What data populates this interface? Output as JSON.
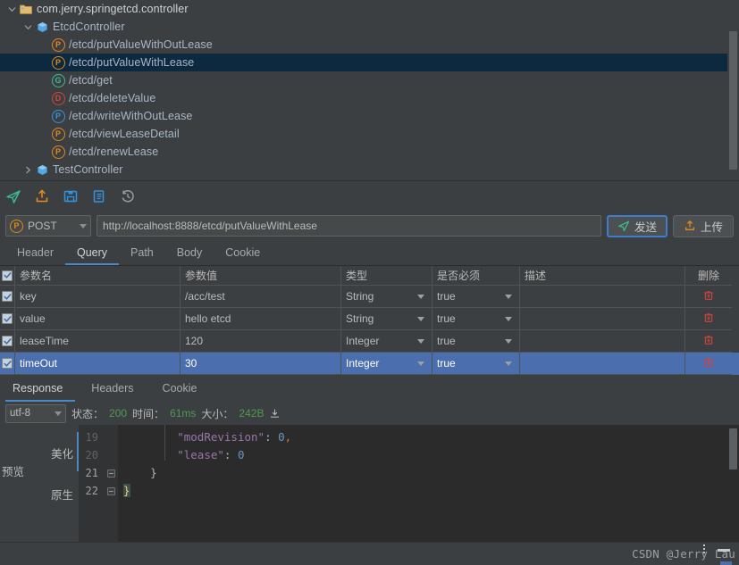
{
  "tree": {
    "items": [
      {
        "label": "com.jerry.springetcd.controller",
        "icon": "folder-icon",
        "indent": 0,
        "chevron": "down",
        "selected": false,
        "kind": "package"
      },
      {
        "label": "EtcdController",
        "icon": "class-icon",
        "indent": 1,
        "chevron": "down",
        "selected": false,
        "kind": "class"
      },
      {
        "label": "/etcd/putValueWithOutLease",
        "icon": "method-badge-post",
        "indent": 2,
        "chevron": "none",
        "selected": false,
        "kind": "endpoint",
        "method": "POST",
        "badge": "P"
      },
      {
        "label": "/etcd/putValueWithLease",
        "icon": "method-badge-post",
        "indent": 2,
        "chevron": "none",
        "selected": true,
        "kind": "endpoint",
        "method": "POST",
        "badge": "P"
      },
      {
        "label": "/etcd/get",
        "icon": "method-badge-get",
        "indent": 2,
        "chevron": "none",
        "selected": false,
        "kind": "endpoint",
        "method": "GET",
        "badge": "G"
      },
      {
        "label": "/etcd/deleteValue",
        "icon": "method-badge-delete",
        "indent": 2,
        "chevron": "none",
        "selected": false,
        "kind": "endpoint",
        "method": "DELETE",
        "badge": "D"
      },
      {
        "label": "/etcd/writeWithOutLease",
        "icon": "method-badge-put",
        "indent": 2,
        "chevron": "none",
        "selected": false,
        "kind": "endpoint",
        "method": "PUT",
        "badge": "P"
      },
      {
        "label": "/etcd/viewLeaseDetail",
        "icon": "method-badge-post",
        "indent": 2,
        "chevron": "none",
        "selected": false,
        "kind": "endpoint",
        "method": "POST",
        "badge": "P"
      },
      {
        "label": "/etcd/renewLease",
        "icon": "method-badge-post",
        "indent": 2,
        "chevron": "none",
        "selected": false,
        "kind": "endpoint",
        "method": "POST",
        "badge": "P"
      },
      {
        "label": "TestController",
        "icon": "class-icon",
        "indent": 1,
        "chevron": "right",
        "selected": false,
        "kind": "class"
      }
    ]
  },
  "toolbar": {
    "icons": [
      {
        "name": "send-icon",
        "color": "#3ebb8f"
      },
      {
        "name": "upload-icon",
        "color": "#e08a1e"
      },
      {
        "name": "save-icon",
        "color": "#3592e0"
      },
      {
        "name": "copy-doc-icon",
        "color": "#3592e0"
      },
      {
        "name": "history-icon",
        "color": "#9a9a9a"
      }
    ]
  },
  "request": {
    "method": "POST",
    "method_badge": "P",
    "url": "http://localhost:8888/etcd/putValueWithLease",
    "url_placeholder": "",
    "send_label": "发送",
    "upload_label": "上传"
  },
  "param_tabs": [
    {
      "label": "Header",
      "active": false
    },
    {
      "label": "Query",
      "active": true
    },
    {
      "label": "Path",
      "active": false
    },
    {
      "label": "Body",
      "active": false
    },
    {
      "label": "Cookie",
      "active": false
    }
  ],
  "params_table": {
    "columns": [
      "参数名",
      "参数值",
      "类型",
      "是否必须",
      "描述",
      "删除"
    ],
    "rows": [
      {
        "checked": true,
        "name": "key",
        "value": "/acc/test",
        "type": "String",
        "required": "true",
        "desc": "",
        "selected": false,
        "editing_cell": ""
      },
      {
        "checked": true,
        "name": "value",
        "value": "hello etcd",
        "type": "String",
        "required": "true",
        "desc": "",
        "selected": false,
        "editing_cell": ""
      },
      {
        "checked": true,
        "name": "leaseTime",
        "value": "120",
        "type": "Integer",
        "required": "true",
        "desc": "",
        "selected": false,
        "editing_cell": ""
      },
      {
        "checked": true,
        "name": "timeOut",
        "value": "30",
        "type": "Integer",
        "required": "true",
        "desc": "",
        "selected": true,
        "editing_cell": "desc"
      }
    ]
  },
  "response_tabs": [
    {
      "label": "Response",
      "active": true
    },
    {
      "label": "Headers",
      "active": false
    },
    {
      "label": "Cookie",
      "active": false
    }
  ],
  "response_status": {
    "encoding": "utf-8",
    "status_label": "状态：",
    "status_value": "200",
    "time_label": "时间：",
    "time_value": "61ms",
    "size_label": "大小：",
    "size_value": "242B",
    "download_icon": "download-icon"
  },
  "viewer_tabs": {
    "preview": "预览",
    "beautify": "美化",
    "raw": "原生"
  },
  "code": {
    "lines": [
      {
        "num": "19",
        "fold": false,
        "indent": 4,
        "tokens": [
          {
            "t": "\"modRevision\"",
            "c": "k"
          },
          {
            "t": ": ",
            "c": "punc"
          },
          {
            "t": "0",
            "c": "num"
          },
          {
            "t": ",",
            "c": "comma"
          }
        ]
      },
      {
        "num": "20",
        "fold": false,
        "indent": 4,
        "tokens": [
          {
            "t": "\"lease\"",
            "c": "k"
          },
          {
            "t": ": ",
            "c": "punc"
          },
          {
            "t": "0",
            "c": "num"
          }
        ]
      },
      {
        "num": "21",
        "fold": true,
        "indent": 2,
        "tokens": [
          {
            "t": "}",
            "c": "punc"
          }
        ]
      },
      {
        "num": "22",
        "fold": true,
        "indent": 0,
        "tokens": [
          {
            "t": "}",
            "c": "brace-hl"
          }
        ]
      }
    ]
  },
  "statusbar": {
    "watermark": "CSDN @Jerry Lau"
  },
  "colors": {
    "bg": "#3c3f41",
    "editor_bg": "#2b2b2b",
    "accent": "#4a88c7",
    "selection_row": "#4b6eaf",
    "tree_selection": "#0d293f",
    "ok_green": "#4e9a51",
    "post_orange": "#e08a1e",
    "get_green": "#3ebb8f",
    "delete_red": "#d0453b",
    "put_blue": "#3592e0"
  }
}
